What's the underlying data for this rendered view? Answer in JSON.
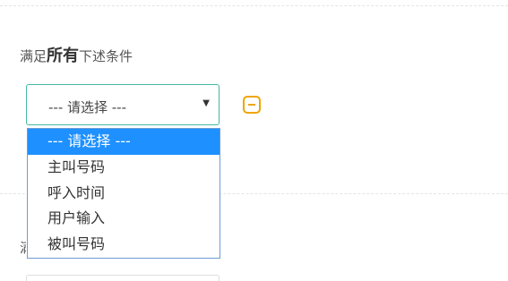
{
  "rule_group": {
    "title_prefix": "满足",
    "title_emphasis": "所有",
    "title_suffix": "下述条件",
    "select": {
      "selected_label": "--- 请选择 ---",
      "arrow_icon": "triangle-down-icon"
    },
    "remove_icon": "minus-square-icon",
    "dropdown_options": [
      "--- 请选择 ---",
      "主叫号码",
      "呼入时间",
      "用户输入",
      "被叫号码"
    ],
    "accent_color": "#45b8a4",
    "remove_color": "#f0a500",
    "selected_option_bg": "#1e90ff"
  },
  "second_group": {
    "title_fragment": "满"
  }
}
